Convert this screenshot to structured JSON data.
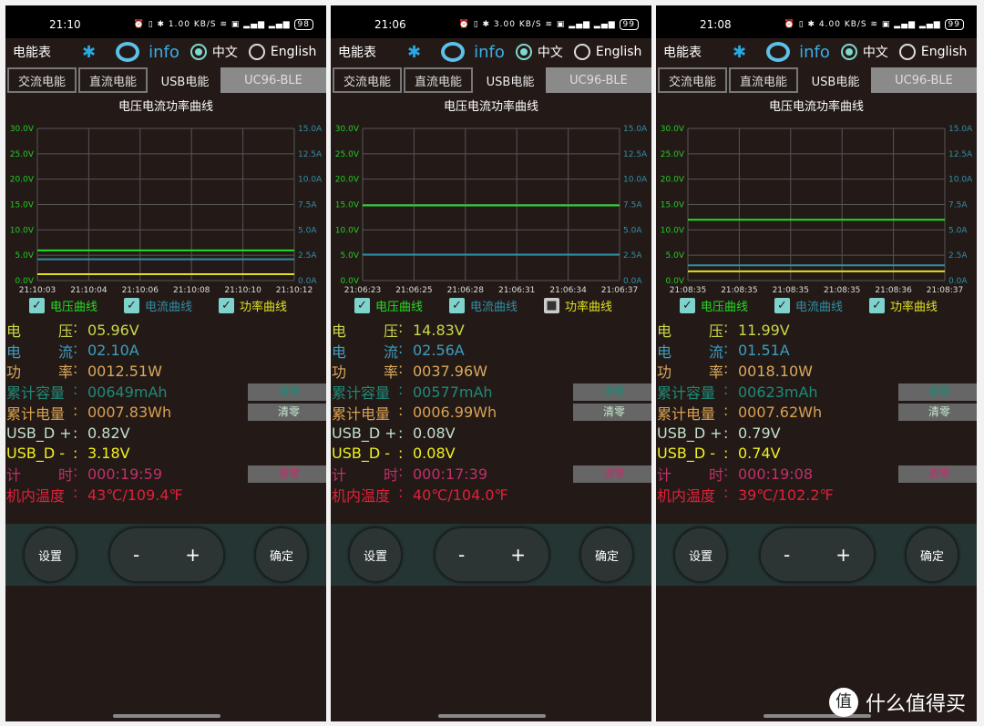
{
  "app": {
    "title": "电能表",
    "info": "info",
    "lang_cn": "中文",
    "lang_en": "English",
    "tabs": [
      "交流电能",
      "直流电能",
      "USB电能",
      "UC96-BLE"
    ],
    "selected_tab": "USB电能",
    "chart_title": "电压电流功率曲线",
    "legend": [
      "电压曲线",
      "电流曲线",
      "功率曲线"
    ],
    "labels": {
      "voltage": [
        "电",
        "压"
      ],
      "current": [
        "电",
        "流"
      ],
      "power": [
        "功",
        "率"
      ],
      "capacity": "累计容量",
      "energy": "累计电量",
      "dplus": "USB_D +",
      "dminus": "USB_D -",
      "timer": [
        "计",
        "时"
      ],
      "temp": "机内温度"
    },
    "clear": "清零",
    "buttons": {
      "settings": "设置",
      "minus": "-",
      "plus": "+",
      "confirm": "确定"
    }
  },
  "colors": {
    "voltage": "#22dd22",
    "current": "#2f8fa8",
    "power": "#e0e020",
    "bg": "#231a17",
    "bar": "#253533"
  },
  "status_icons": "alarm-icon vibrate-icon bluetooth-icon wifi-icon hd-icon signal-icon battery-icon",
  "panels": [
    {
      "status": {
        "time": "21:10",
        "speed": "1.00 KB/S",
        "battery": "98"
      },
      "chart_data": {
        "type": "line",
        "y_left": {
          "ticks": [
            "0.0V",
            "5.0V",
            "10.0V",
            "15.0V",
            "20.0V",
            "25.0V",
            "30.0V"
          ],
          "range": [
            0,
            30
          ]
        },
        "y_right": {
          "ticks": [
            "0.0A",
            "2.5A",
            "5.0A",
            "7.5A",
            "10.0A",
            "12.5A",
            "15.0A"
          ],
          "range": [
            0,
            15
          ]
        },
        "x_ticks": [
          "21:10:03",
          "21:10:04",
          "21:10:06",
          "21:10:08",
          "21:10:10",
          "21:10:12"
        ],
        "grid": true,
        "series": [
          {
            "name": "电压曲线",
            "value": 5.96
          },
          {
            "name": "电流曲线",
            "value": 2.1
          },
          {
            "name": "功率曲线",
            "value": 12.51
          }
        ]
      },
      "legend_checked": [
        true,
        true,
        true
      ],
      "values": {
        "voltage": "05.96V",
        "current": "02.10A",
        "power": "0012.51W",
        "capacity": "00649mAh",
        "energy": "0007.83Wh",
        "dplus": "0.82V",
        "dminus": "3.18V",
        "timer": "000:19:59",
        "temp": "43℃/109.4℉"
      }
    },
    {
      "status": {
        "time": "21:06",
        "speed": "3.00 KB/S",
        "battery": "99"
      },
      "chart_data": {
        "type": "line",
        "y_left": {
          "ticks": [
            "0.0V",
            "5.0V",
            "10.0V",
            "15.0V",
            "20.0V",
            "25.0V",
            "30.0V"
          ],
          "range": [
            0,
            30
          ]
        },
        "y_right": {
          "ticks": [
            "0.0A",
            "2.5A",
            "5.0A",
            "7.5A",
            "10.0A",
            "12.5A",
            "15.0A"
          ],
          "range": [
            0,
            15
          ]
        },
        "x_ticks": [
          "21:06:23",
          "21:06:25",
          "21:06:28",
          "21:06:31",
          "21:06:34",
          "21:06:37"
        ],
        "grid": true,
        "series": [
          {
            "name": "电压曲线",
            "value": 14.83
          },
          {
            "name": "电流曲线",
            "value": 2.56
          }
        ]
      },
      "legend_checked": [
        true,
        true,
        false
      ],
      "values": {
        "voltage": "14.83V",
        "current": "02.56A",
        "power": "0037.96W",
        "capacity": "00577mAh",
        "energy": "0006.99Wh",
        "dplus": "0.08V",
        "dminus": "0.08V",
        "timer": "000:17:39",
        "temp": "40℃/104.0℉"
      }
    },
    {
      "status": {
        "time": "21:08",
        "speed": "4.00 KB/S",
        "battery": "99"
      },
      "chart_data": {
        "type": "line",
        "y_left": {
          "ticks": [
            "0.0V",
            "5.0V",
            "10.0V",
            "15.0V",
            "20.0V",
            "25.0V",
            "30.0V"
          ],
          "range": [
            0,
            30
          ]
        },
        "y_right": {
          "ticks": [
            "0.0A",
            "2.5A",
            "5.0A",
            "7.5A",
            "10.0A",
            "12.5A",
            "15.0A"
          ],
          "range": [
            0,
            15
          ]
        },
        "x_ticks": [
          "21:08:35",
          "21:08:35",
          "21:08:35",
          "21:08:35",
          "21:08:36",
          "21:08:37"
        ],
        "grid": true,
        "series": [
          {
            "name": "电压曲线",
            "value": 11.99
          },
          {
            "name": "电流曲线",
            "value": 1.51
          },
          {
            "name": "功率曲线",
            "value": 18.1
          }
        ]
      },
      "legend_checked": [
        true,
        true,
        true
      ],
      "values": {
        "voltage": "11.99V",
        "current": "01.51A",
        "power": "0018.10W",
        "capacity": "00623mAh",
        "energy": "0007.62Wh",
        "dplus": "0.79V",
        "dminus": "0.74V",
        "timer": "000:19:08",
        "temp": "39℃/102.2℉"
      }
    }
  ],
  "watermark": {
    "logo": "值",
    "text": "什么值得买"
  }
}
